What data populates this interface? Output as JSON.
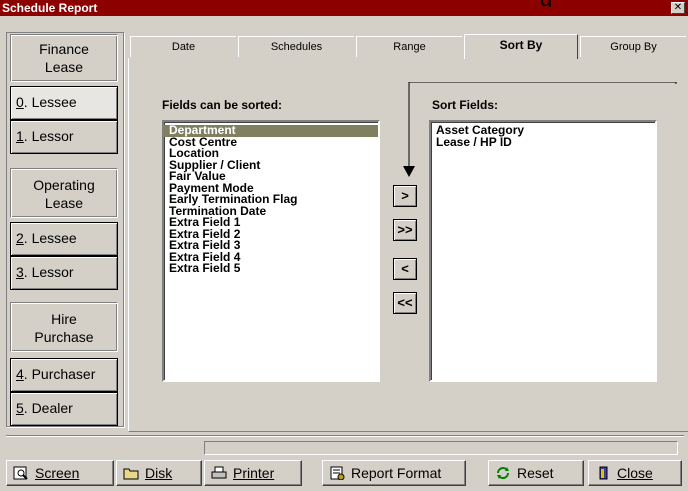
{
  "window": {
    "title": "Schedule Report",
    "peek_text": "g",
    "close_glyph": "✕"
  },
  "sidebar": {
    "groups": [
      {
        "label": "Finance Lease",
        "buttons": [
          {
            "key": "0",
            "label": ". Lessee",
            "active": true
          },
          {
            "key": "1",
            "label": ". Lessor",
            "active": false
          }
        ]
      },
      {
        "label": "Operating Lease",
        "buttons": [
          {
            "key": "2",
            "label": ". Lessee",
            "active": false
          },
          {
            "key": "3",
            "label": ". Lessor",
            "active": false
          }
        ]
      },
      {
        "label": "Hire Purchase",
        "buttons": [
          {
            "key": "4",
            "label": ". Purchaser",
            "active": false
          },
          {
            "key": "5",
            "label": ". Dealer",
            "active": false
          }
        ]
      }
    ]
  },
  "tabs": [
    {
      "label": "Date",
      "selected": false
    },
    {
      "label": "Schedules",
      "selected": false
    },
    {
      "label": "Range",
      "selected": false
    },
    {
      "label": "Sort By",
      "selected": true
    },
    {
      "label": "Group By",
      "selected": false
    }
  ],
  "sortby": {
    "fields_label": "Fields can be sorted:",
    "sort_label": "Sort Fields:",
    "available": [
      "Department",
      "Cost Centre",
      "Location",
      "Supplier / Client",
      "Fair Value",
      "Payment Mode",
      "Early Termination Flag",
      "Termination Date",
      "Extra Field 1",
      "Extra Field 2",
      "Extra Field 3",
      "Extra Field 4",
      "Extra Field 5"
    ],
    "selected_index": 0,
    "sort_fields": [
      "Asset Category",
      "Lease / HP ID"
    ],
    "buttons": [
      ">",
      ">>",
      "<",
      "<<"
    ]
  },
  "bottom": {
    "screen": "Screen",
    "disk": "Disk",
    "printer": "Printer",
    "report_format": "Report Format",
    "reset": "Reset",
    "close": "Close"
  },
  "colors": {
    "title_bar": "#8c0000",
    "face": "#d4d0c8",
    "selected_item": "#808060"
  }
}
